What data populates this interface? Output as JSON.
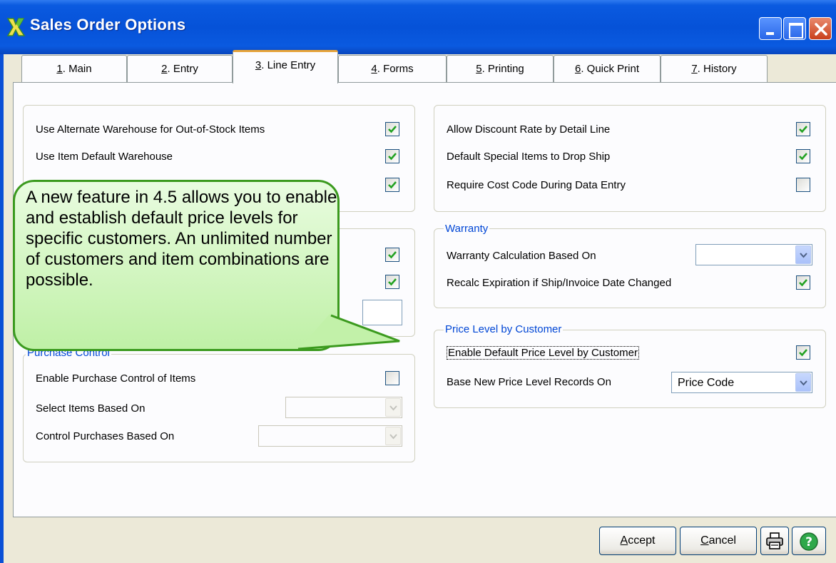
{
  "window": {
    "title": "Sales Order Options"
  },
  "tabs": [
    {
      "num": "1",
      "label": ". Main"
    },
    {
      "num": "2",
      "label": ". Entry"
    },
    {
      "num": "3",
      "label": ". Line Entry"
    },
    {
      "num": "4",
      "label": ". Forms"
    },
    {
      "num": "5",
      "label": ". Printing"
    },
    {
      "num": "6",
      "label": ". Quick Print"
    },
    {
      "num": "7",
      "label": ". History"
    }
  ],
  "active_tab": "3. Line Entry",
  "left_top": {
    "options": [
      {
        "label": "Use Alternate Warehouse for Out-of-Stock Items",
        "checked": true
      },
      {
        "label": "Use Item Default Warehouse",
        "checked": true
      },
      {
        "label": "",
        "checked": true
      }
    ]
  },
  "left_mid": {
    "options": [
      {
        "checked": true
      },
      {
        "checked": true
      }
    ]
  },
  "purchase_control": {
    "title": "Purchase Control",
    "enable_label": "Enable Purchase Control of Items",
    "enable_checked": false,
    "select_items_label": "Select Items Based On",
    "select_items_value": "",
    "control_purchases_label": "Control Purchases Based On",
    "control_purchases_value": ""
  },
  "right_top": {
    "options": [
      {
        "label": "Allow Discount Rate by Detail Line",
        "checked": true
      },
      {
        "label": "Default Special Items to Drop Ship",
        "checked": true
      },
      {
        "label": "Require Cost Code During Data Entry",
        "checked": false
      }
    ]
  },
  "warranty": {
    "title": "Warranty",
    "calc_label": "Warranty Calculation Based On",
    "calc_value": "",
    "recalc_label": "Recalc Expiration if Ship/Invoice Date Changed",
    "recalc_checked": true
  },
  "price_level": {
    "title": "Price Level by Customer",
    "enable_label": "Enable Default Price Level by Customer",
    "enable_checked": true,
    "base_label": "Base New Price Level Records On",
    "base_value": "Price Code"
  },
  "buttons": {
    "accept_u": "A",
    "accept_rest": "ccept",
    "cancel_u": "C",
    "cancel_rest": "ancel"
  },
  "icons": {
    "print": "printer-icon",
    "help": "help-icon",
    "app": "sage-x-icon"
  },
  "callout": {
    "text": "A new feature in 4.5 allows you to enable and establish default price levels for specific customers. An unlimited number of customers and item combinations are possible."
  },
  "colors": {
    "titlebar": "#0652d8",
    "group_title": "#0046d5",
    "check": "#21a121",
    "callout_fill": "#c8f3b0",
    "callout_border": "#3b9a1e",
    "help_button": "#2fa84a"
  }
}
